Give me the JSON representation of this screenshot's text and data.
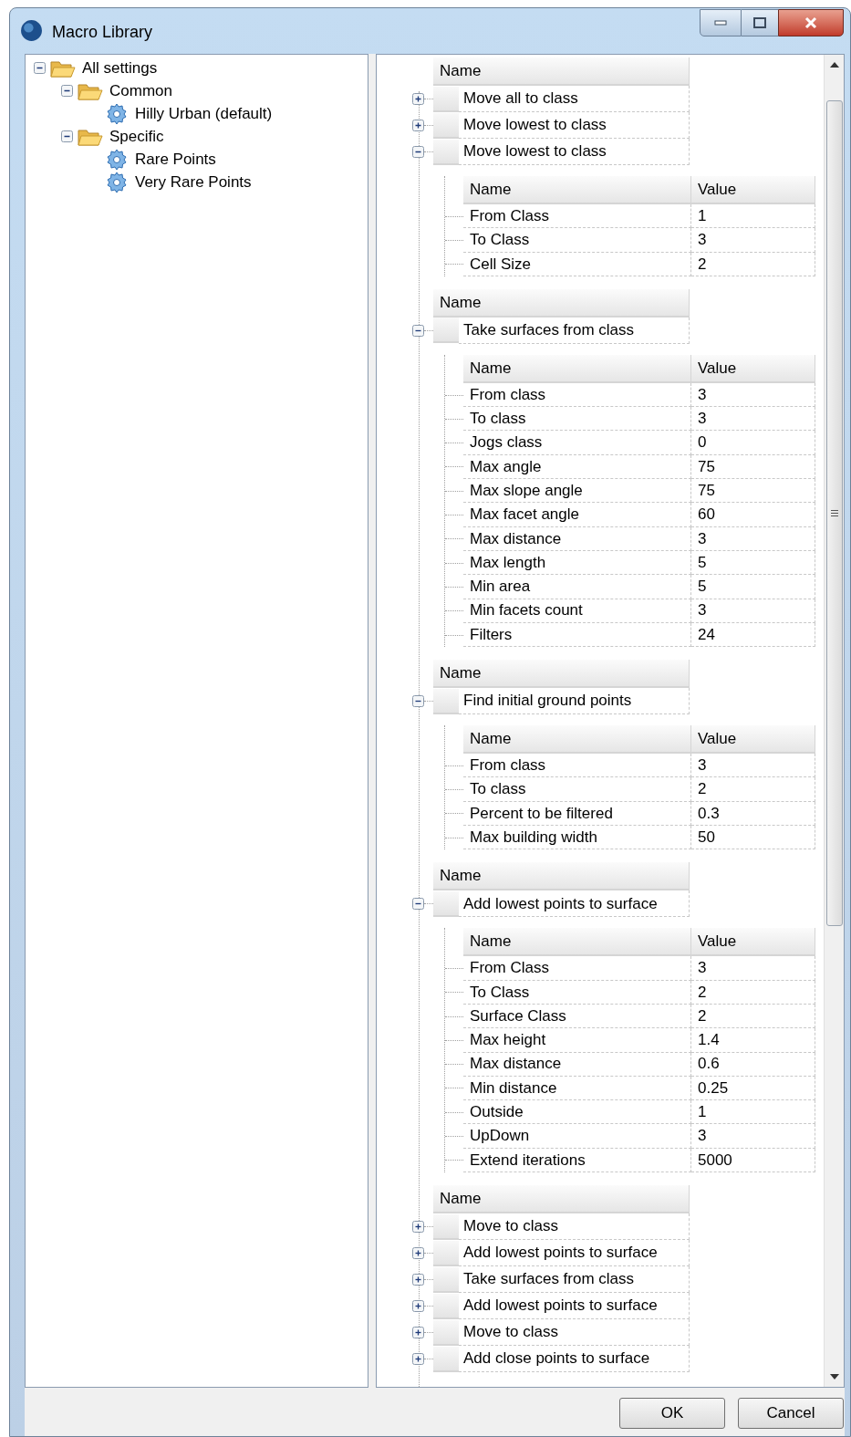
{
  "window": {
    "title": "Macro Library"
  },
  "tree": [
    {
      "label": "All settings",
      "kind": "folder",
      "expanded": true,
      "children": [
        {
          "label": "Common",
          "kind": "folder",
          "expanded": true,
          "children": [
            {
              "label": "Hilly Urban (default)",
              "kind": "settings"
            }
          ]
        },
        {
          "label": "Specific",
          "kind": "folder",
          "expanded": true,
          "children": [
            {
              "label": "Rare Points",
              "kind": "settings"
            },
            {
              "label": "Very Rare Points",
              "kind": "settings"
            }
          ]
        }
      ]
    }
  ],
  "groups": [
    {
      "header": "Name",
      "rows": [
        {
          "label": "Move all to class",
          "expanded": false
        },
        {
          "label": "Move lowest to class",
          "expanded": false
        },
        {
          "label": "Move lowest to class",
          "expanded": true,
          "params": {
            "columns": [
              "Name",
              "Value"
            ],
            "rows": [
              [
                "From Class",
                "1"
              ],
              [
                "To Class",
                "3"
              ],
              [
                "Cell Size",
                "2"
              ]
            ]
          }
        }
      ]
    },
    {
      "header": "Name",
      "rows": [
        {
          "label": "Take surfaces from class",
          "expanded": true,
          "params": {
            "columns": [
              "Name",
              "Value"
            ],
            "rows": [
              [
                "From class",
                "3"
              ],
              [
                "To class",
                "3"
              ],
              [
                "Jogs class",
                "0"
              ],
              [
                "Max angle",
                "75"
              ],
              [
                "Max slope angle",
                "75"
              ],
              [
                "Max facet angle",
                "60"
              ],
              [
                "Max distance",
                "3"
              ],
              [
                "Max length",
                "5"
              ],
              [
                "Min area",
                "5"
              ],
              [
                "Min facets count",
                "3"
              ],
              [
                "Filters",
                "24"
              ]
            ]
          }
        }
      ]
    },
    {
      "header": "Name",
      "rows": [
        {
          "label": "Find initial ground points",
          "expanded": true,
          "params": {
            "columns": [
              "Name",
              "Value"
            ],
            "rows": [
              [
                "From class",
                "3"
              ],
              [
                "To class",
                "2"
              ],
              [
                "Percent to be filtered",
                "0.3"
              ],
              [
                "Max building width",
                "50"
              ]
            ]
          }
        }
      ]
    },
    {
      "header": "Name",
      "rows": [
        {
          "label": "Add lowest points to surface",
          "expanded": true,
          "params": {
            "columns": [
              "Name",
              "Value"
            ],
            "rows": [
              [
                "From Class",
                "3"
              ],
              [
                "To Class",
                "2"
              ],
              [
                "Surface Class",
                "2"
              ],
              [
                "Max height",
                "1.4"
              ],
              [
                "Max distance",
                "0.6"
              ],
              [
                "Min distance",
                "0.25"
              ],
              [
                "Outside",
                "1"
              ],
              [
                "UpDown",
                "3"
              ],
              [
                "Extend iterations",
                "5000"
              ]
            ]
          }
        }
      ]
    },
    {
      "header": "Name",
      "rows": [
        {
          "label": "Move to class",
          "expanded": false
        },
        {
          "label": "Add lowest points to surface",
          "expanded": false
        },
        {
          "label": "Take surfaces from class",
          "expanded": false
        },
        {
          "label": "Add lowest points to surface",
          "expanded": false
        },
        {
          "label": "Move to class",
          "expanded": false
        },
        {
          "label": "Add close points to surface",
          "expanded": false
        }
      ]
    }
  ],
  "buttons": [
    "OK",
    "Cancel"
  ]
}
